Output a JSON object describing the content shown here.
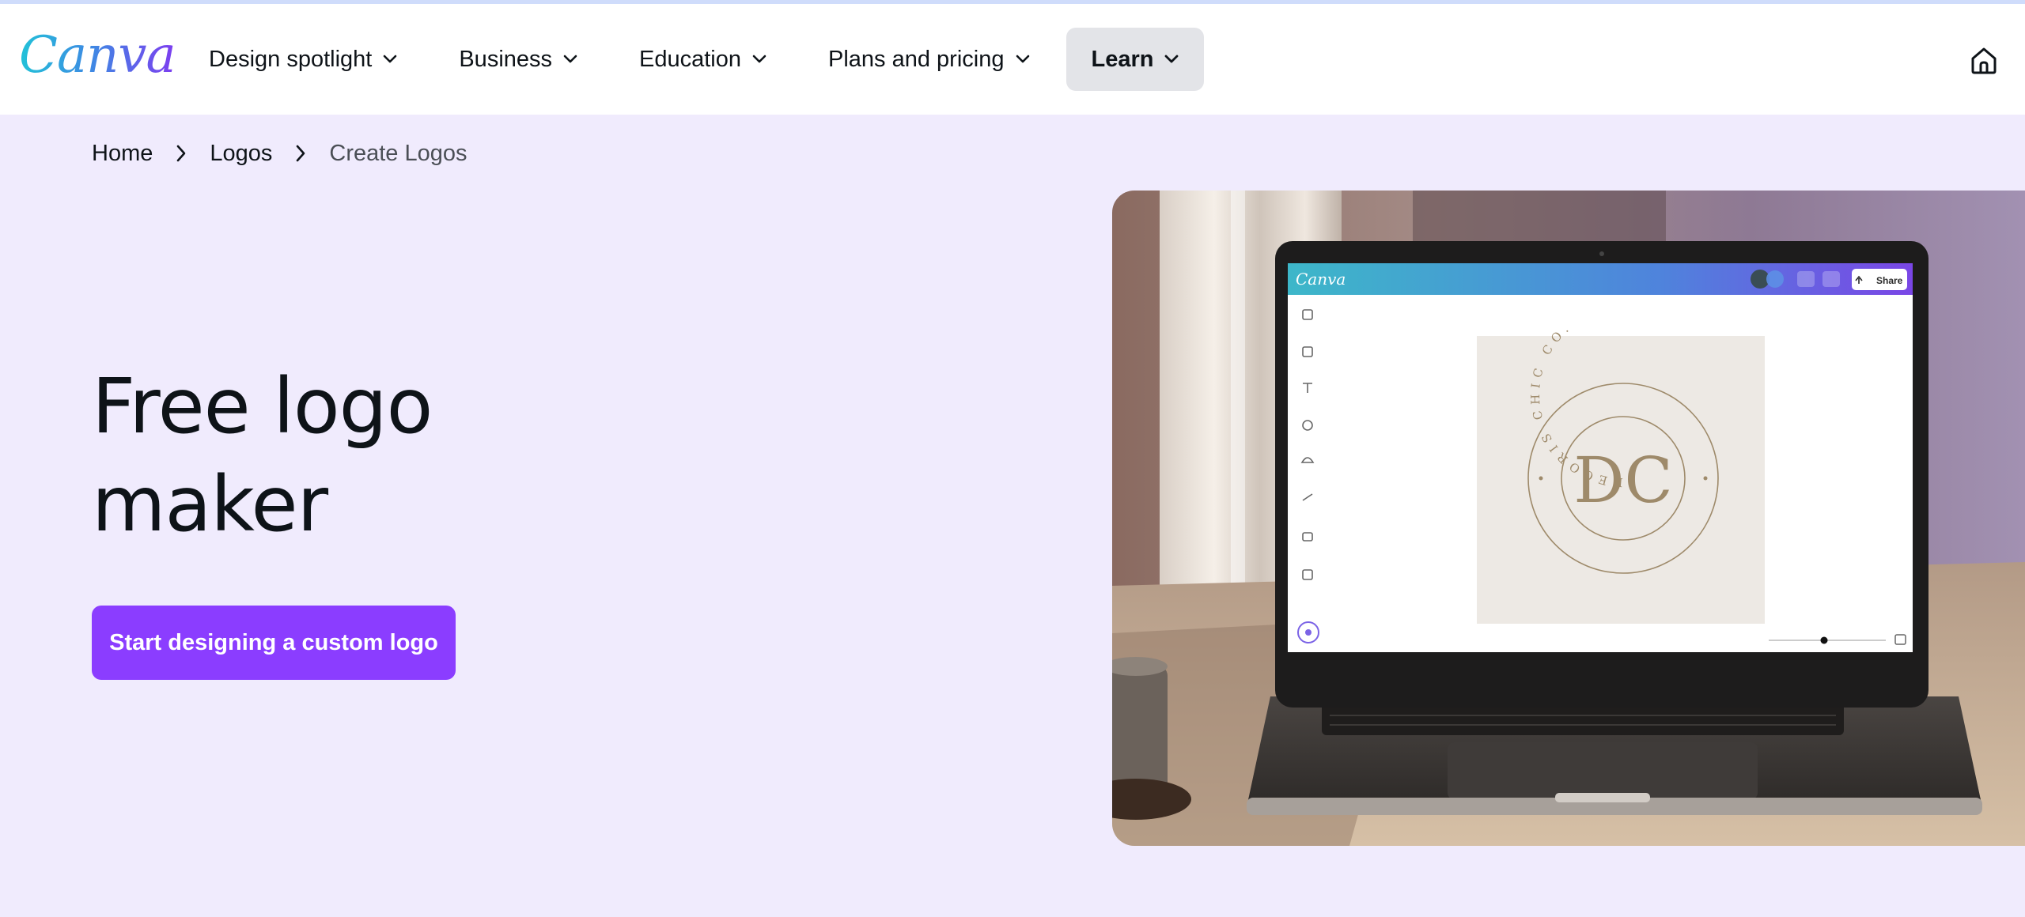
{
  "brand": {
    "logo_text": "Canva"
  },
  "nav": {
    "items": [
      {
        "label": "Design spotlight"
      },
      {
        "label": "Business"
      },
      {
        "label": "Education"
      },
      {
        "label": "Plans and pricing"
      },
      {
        "label": "Learn"
      }
    ]
  },
  "breadcrumb": {
    "items": [
      "Home",
      "Logos",
      "Create Logos"
    ]
  },
  "hero": {
    "title_line1": "Free logo",
    "title_line2": "maker",
    "cta_label": "Start designing a custom logo"
  },
  "laptop_screen": {
    "app_logo": "Canva",
    "share_label": "Share",
    "design_monogram": "DC",
    "design_ring_text": "DECORIS CHIC CO."
  },
  "colors": {
    "page_bg": "#f0ebfd",
    "cta_bg": "#8b3dff",
    "nav_active_bg": "#e3e4e8",
    "design_card_bg": "#ede9e4",
    "design_gold": "#9e8a6a"
  }
}
